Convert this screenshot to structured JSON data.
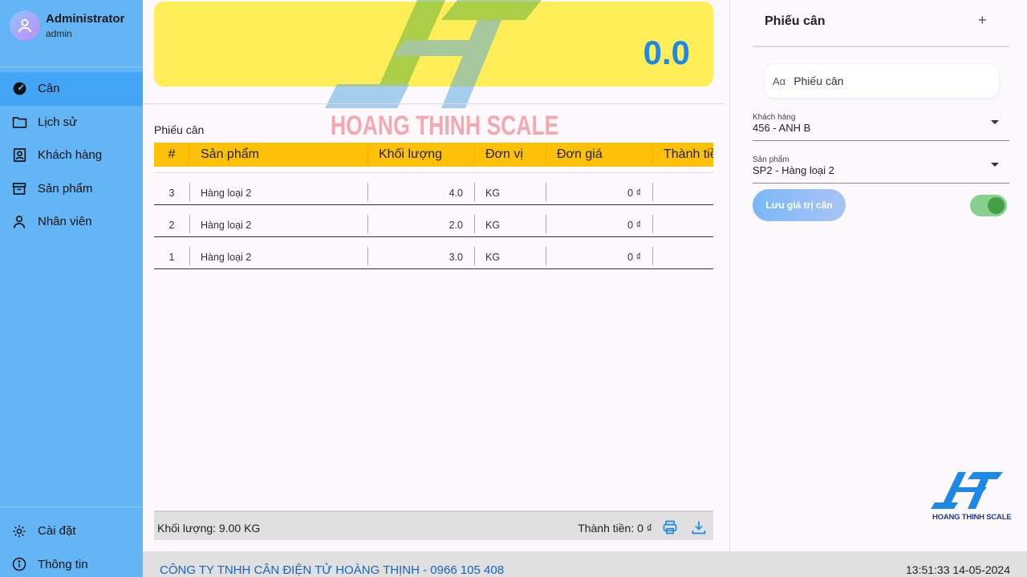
{
  "user": {
    "name": "Administrator",
    "role": "admin"
  },
  "nav": [
    {
      "label": "Cân",
      "icon": "gauge-icon",
      "active": true
    },
    {
      "label": "Lịch sử",
      "icon": "folder-icon"
    },
    {
      "label": "Khách hàng",
      "icon": "contact-book-icon"
    },
    {
      "label": "Sản phẩm",
      "icon": "archive-box-icon"
    },
    {
      "label": "Nhân viên",
      "icon": "person-icon"
    }
  ],
  "nav_bottom": [
    {
      "label": "Cài đặt",
      "icon": "gear-icon"
    },
    {
      "label": "Thông tin",
      "icon": "info-icon"
    }
  ],
  "display": {
    "value": "0.0"
  },
  "watermark": {
    "text": "HOANG THINH SCALE"
  },
  "ticket": {
    "title": "Phiếu cân",
    "columns": [
      "#",
      "Sản phẩm",
      "Khối lượng",
      "Đơn vị",
      "Đơn giá",
      "Thành tiền"
    ],
    "rows": [
      {
        "no": "3",
        "product": "Hàng loại 2",
        "weight": "4.0",
        "unit": "KG",
        "price": "0 ₫"
      },
      {
        "no": "2",
        "product": "Hàng loại 2",
        "weight": "2.0",
        "unit": "KG",
        "price": "0 ₫"
      },
      {
        "no": "1",
        "product": "Hàng loại 2",
        "weight": "3.0",
        "unit": "KG",
        "price": "0 ₫"
      }
    ],
    "total_weight": "Khối lượng: 9.00 KG",
    "total_amount": "Thành tiền: 0 ₫"
  },
  "panel": {
    "title": "Phiếu cân",
    "input_value": "Phiếu cân",
    "customer": {
      "label": "Khách hàng",
      "value": "456 - ANH B"
    },
    "product": {
      "label": "Sản phẩm",
      "value": "SP2 - Hàng loại 2"
    },
    "save_label": "Lưu giá trị cân",
    "toggle_on": true,
    "logo_text": "HOANG THINH SCALE"
  },
  "status": {
    "company": "CÔNG TY TNHH CÂN ĐIỆN TỬ HOÀNG THỊNH - 0966 105 408",
    "datetime": "13:51:33 14-05-2024"
  },
  "colors": {
    "sidebar": "#64b5f6",
    "active": "#42a5f5",
    "display": "#ffee58",
    "header": "#ffc107",
    "value": "#1e88e5"
  }
}
